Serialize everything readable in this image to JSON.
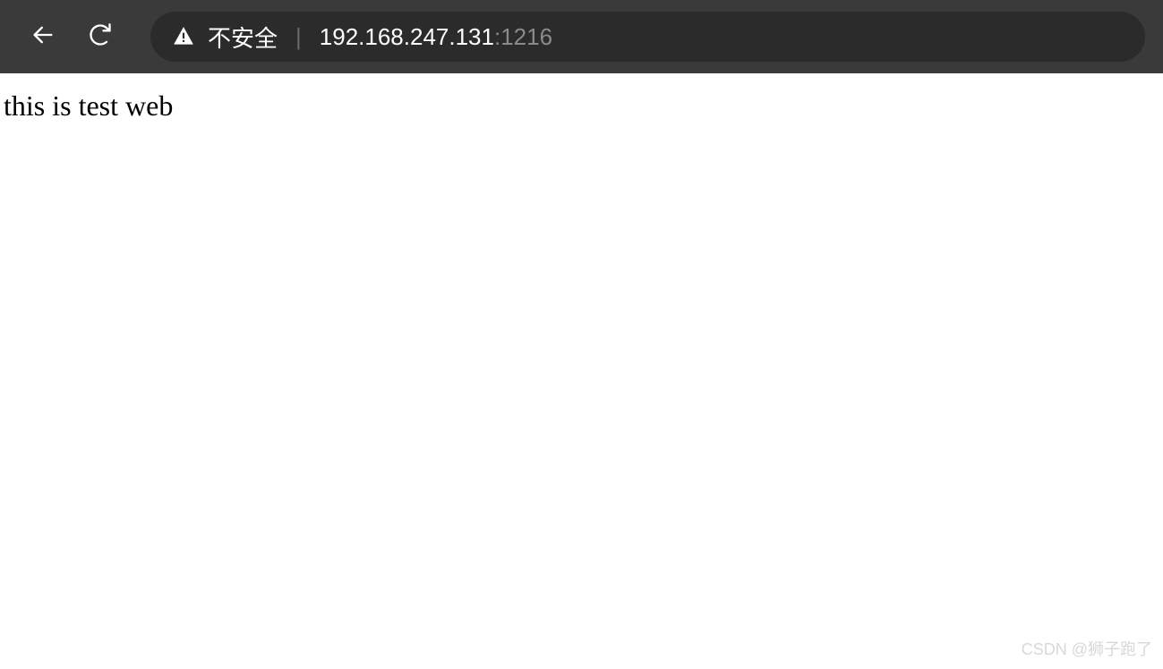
{
  "toolbar": {
    "security_label": "不安全",
    "url_host": "192.168.247.131",
    "url_port": ":1216"
  },
  "page": {
    "body_text": "this is test web"
  },
  "watermark": {
    "text": "CSDN @狮子跑了"
  }
}
